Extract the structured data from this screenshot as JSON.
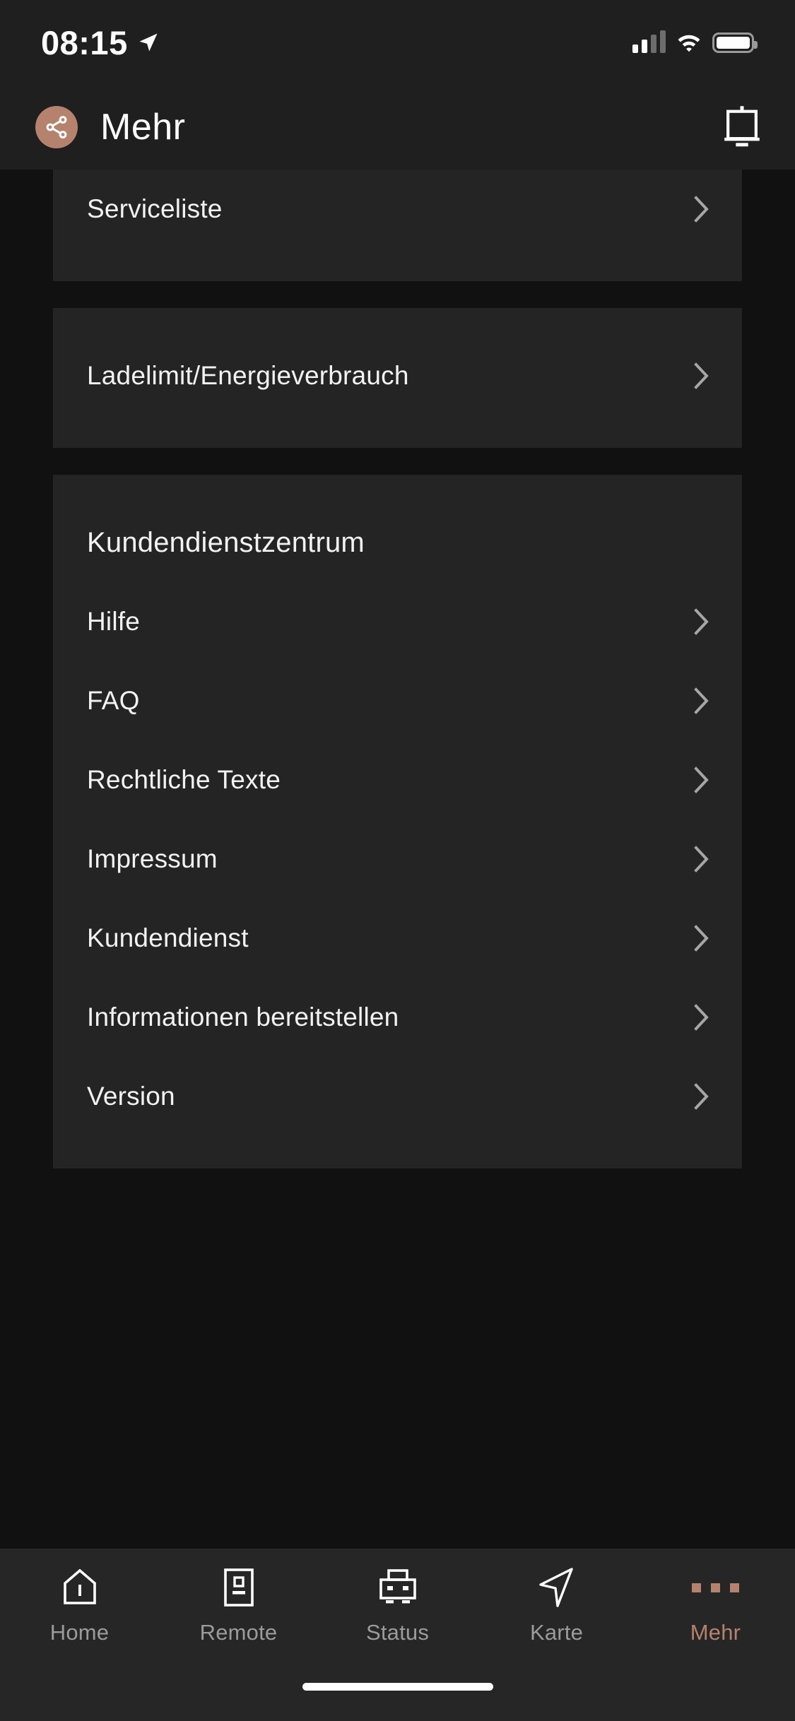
{
  "status_bar": {
    "time": "08:15",
    "location_icon": "location-arrow-icon",
    "signal_icon": "cellular-signal-icon",
    "wifi_icon": "wifi-icon",
    "battery_icon": "battery-full-icon"
  },
  "header": {
    "avatar_icon": "share-network-icon",
    "avatar_color": "#b5836d",
    "title": "Mehr",
    "action_icon": "vehicle-key-icon"
  },
  "cards": [
    {
      "name": "serviceliste-card",
      "clipped": true,
      "section_title": null,
      "items": [
        {
          "label": "Serviceliste",
          "chevron": "chevron-right-icon"
        }
      ]
    },
    {
      "name": "ladelimit-card",
      "clipped": false,
      "section_title": null,
      "items": [
        {
          "label": "Ladelimit/Energieverbrauch",
          "chevron": "chevron-right-icon"
        }
      ]
    },
    {
      "name": "kundendienstzentrum-card",
      "clipped": false,
      "section_title": "Kundendienstzentrum",
      "items": [
        {
          "label": "Hilfe",
          "chevron": "chevron-right-icon"
        },
        {
          "label": "FAQ",
          "chevron": "chevron-right-icon"
        },
        {
          "label": "Rechtliche Texte",
          "chevron": "chevron-right-icon"
        },
        {
          "label": "Impressum",
          "chevron": "chevron-right-icon"
        },
        {
          "label": "Kundendienst",
          "chevron": "chevron-right-icon"
        },
        {
          "label": "Informationen bereitstellen",
          "chevron": "chevron-right-icon"
        },
        {
          "label": "Version",
          "chevron": "chevron-right-icon"
        }
      ]
    }
  ],
  "tabbar": {
    "active_color": "#b5836d",
    "inactive_color": "#9b9b9b",
    "tabs": [
      {
        "label": "Home",
        "icon": "home-icon",
        "active": false
      },
      {
        "label": "Remote",
        "icon": "remote-key-icon",
        "active": false
      },
      {
        "label": "Status",
        "icon": "vehicle-icon",
        "active": false
      },
      {
        "label": "Karte",
        "icon": "navigation-arrow-icon",
        "active": false
      },
      {
        "label": "Mehr",
        "icon": "more-dots-icon",
        "active": true
      }
    ]
  },
  "home_indicator": "home-indicator-bar"
}
